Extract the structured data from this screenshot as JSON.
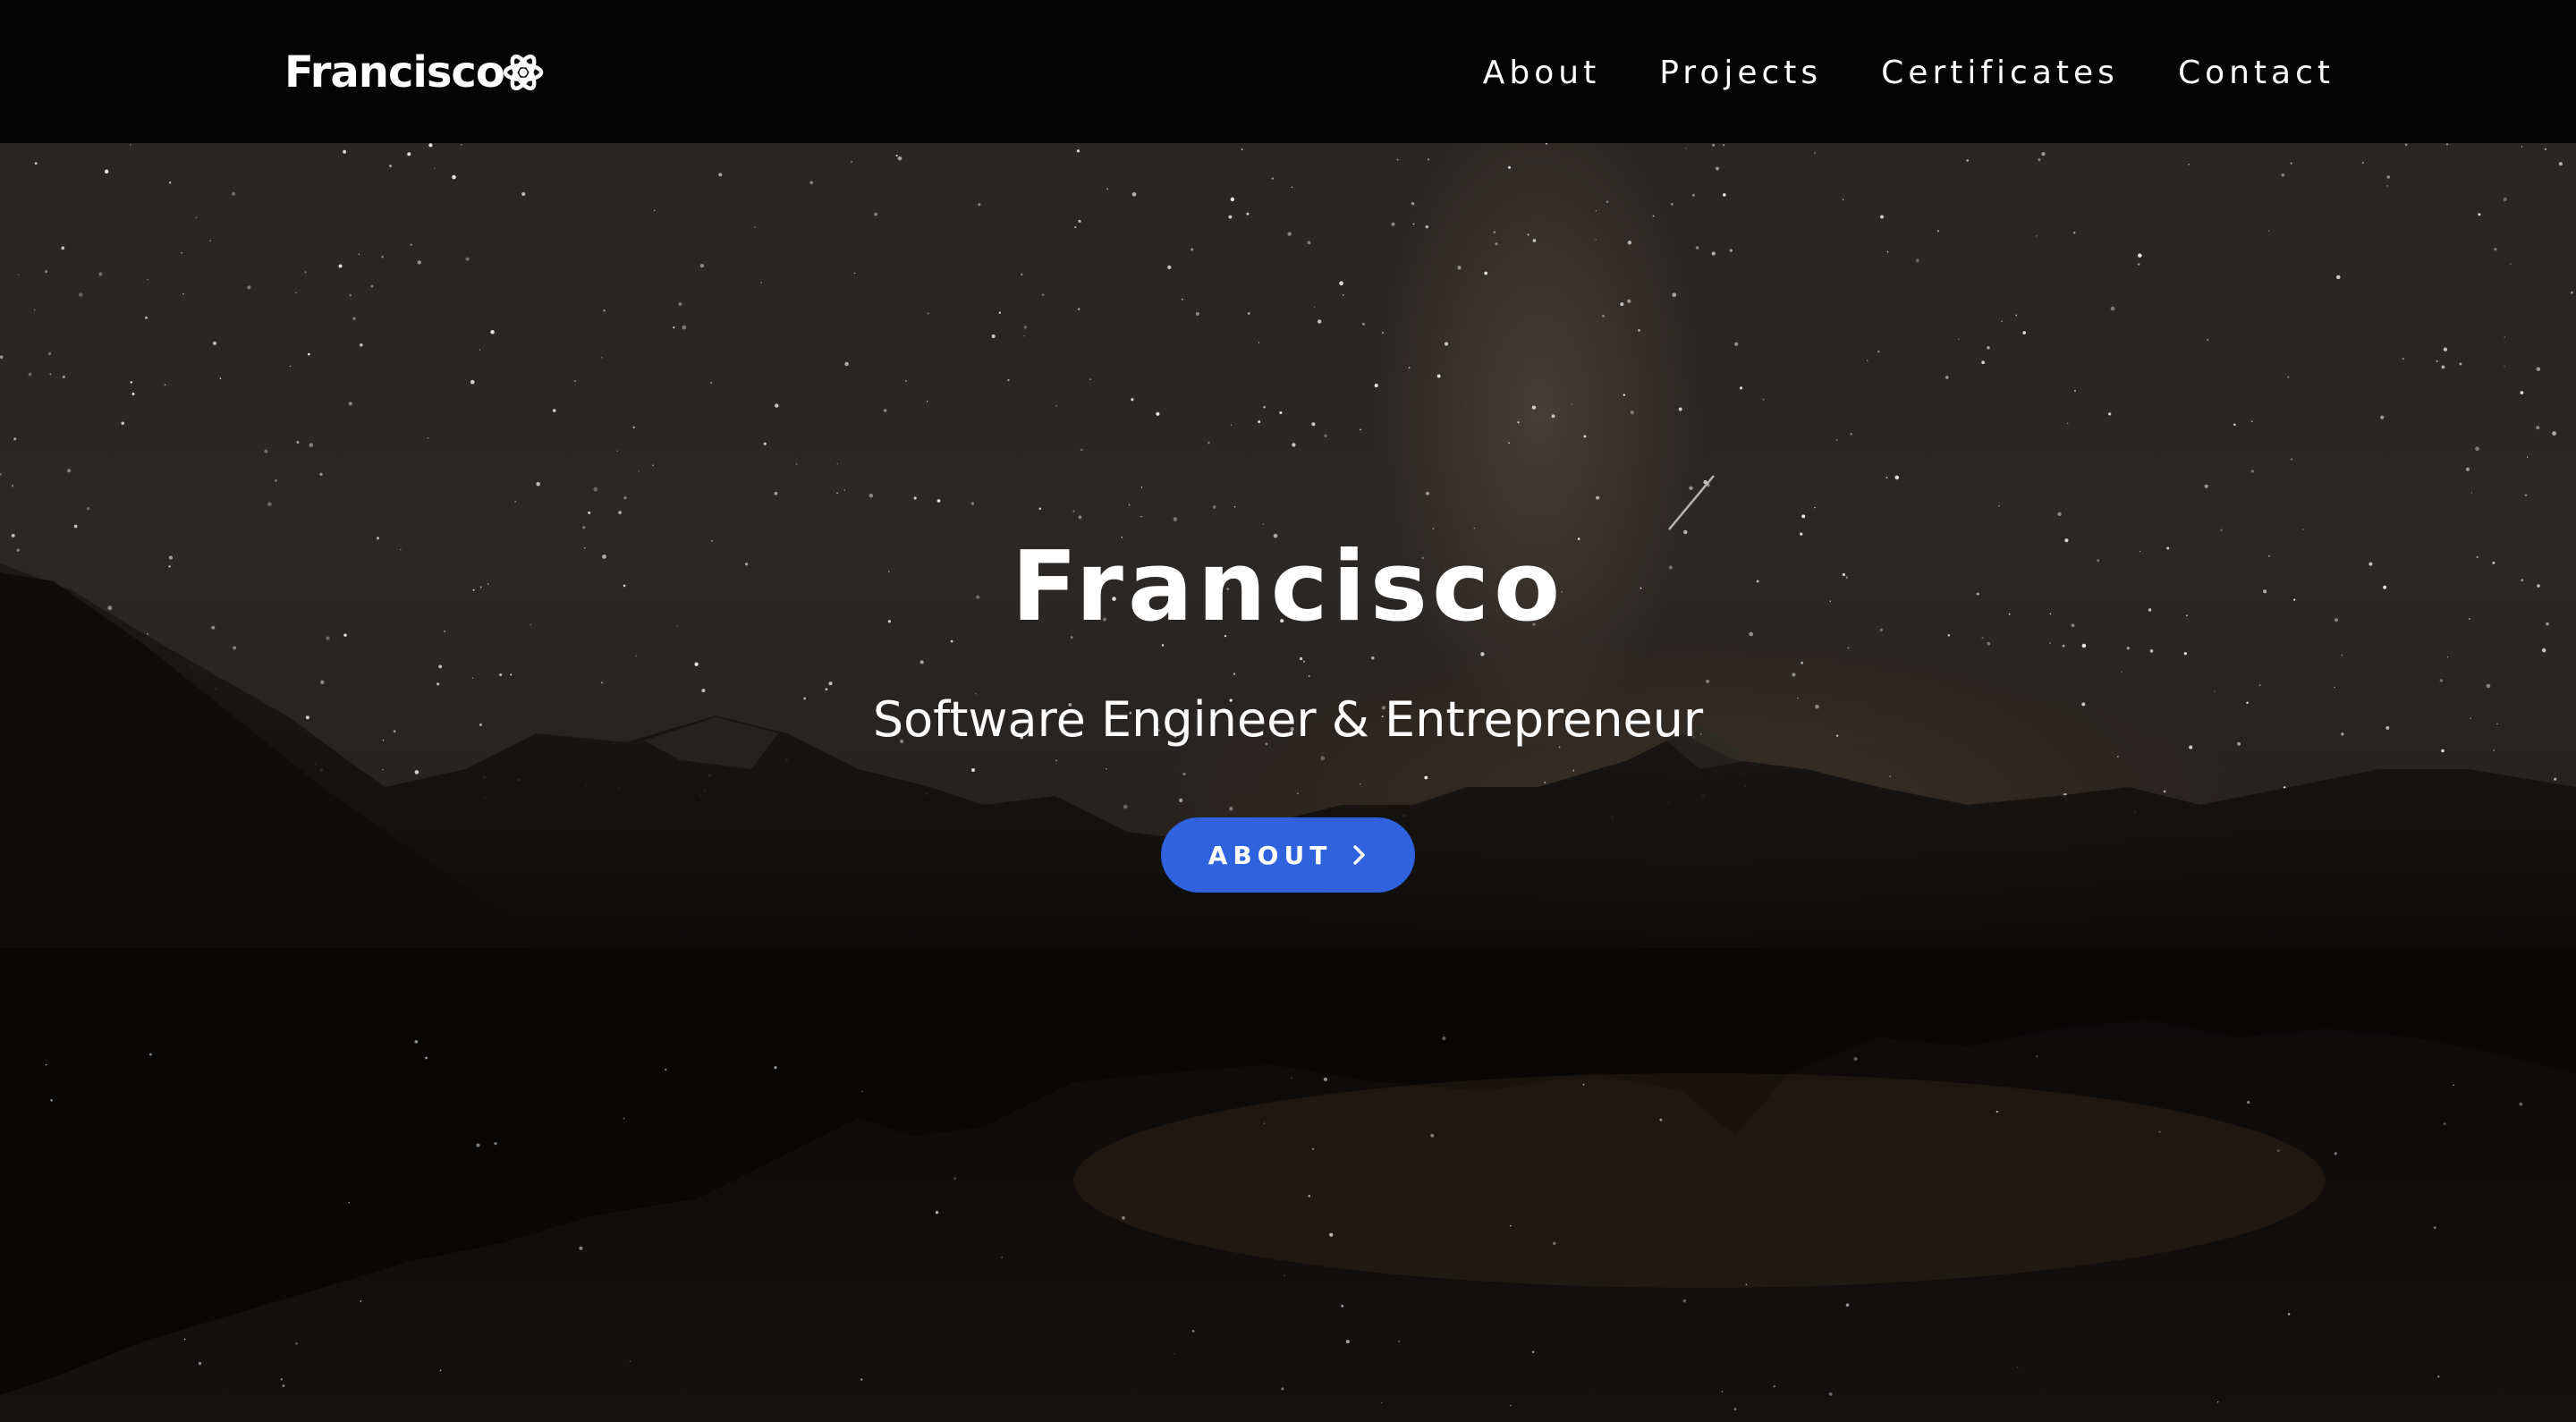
{
  "nav": {
    "brand": "Francisco",
    "brand_icon": "atom-icon",
    "links": [
      "About",
      "Projects",
      "Certificates",
      "Contact"
    ]
  },
  "hero": {
    "title": "Francisco",
    "subtitle": "Software Engineer & Entrepreneur",
    "button_label": "ABOUT",
    "button_icon": "chevron-right-icon"
  },
  "colors": {
    "navbar_bg": "#040404",
    "accent": "#2f62dd",
    "text": "#ffffff"
  }
}
